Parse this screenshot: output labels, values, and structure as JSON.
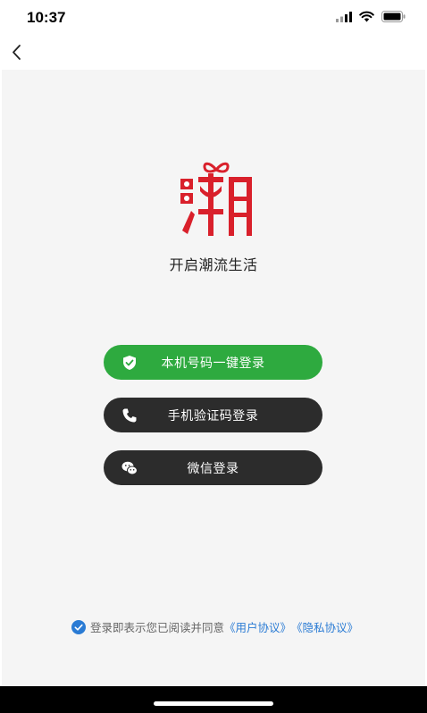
{
  "status_bar": {
    "time": "10:37"
  },
  "brand": {
    "slogan": "开启潮流生活"
  },
  "login_options": {
    "one_click": "本机号码一键登录",
    "sms": "手机验证码登录",
    "wechat": "微信登录"
  },
  "agreement": {
    "prefix": "登录即表示您已阅读并同意",
    "user_agreement": "《用户协议》",
    "privacy_policy": "《隐私协议》",
    "checked": true
  },
  "colors": {
    "primary_green": "#2eaa3f",
    "dark_button": "#2c2c2c",
    "link_blue": "#2a7bd4",
    "logo_red": "#d9202b"
  }
}
